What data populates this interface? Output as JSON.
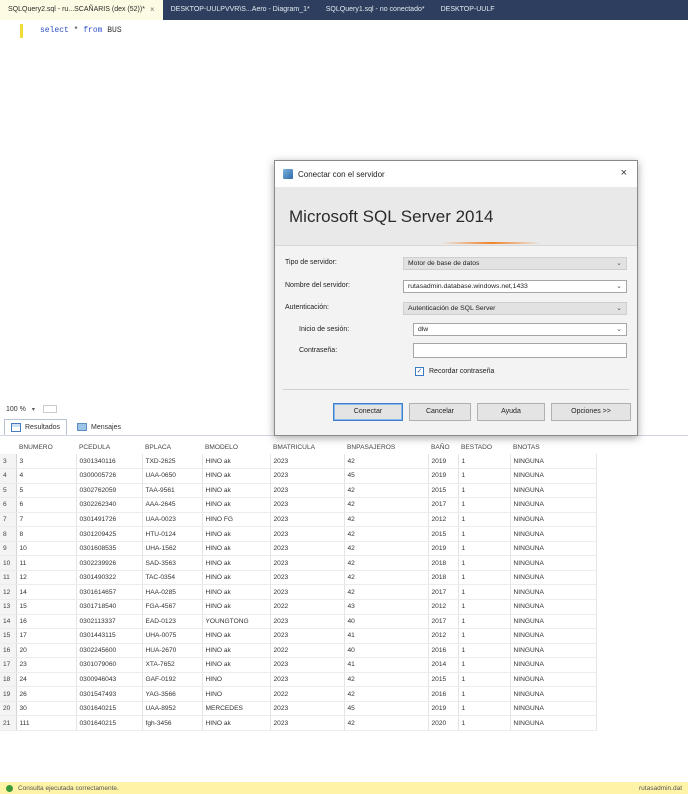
{
  "tabs": [
    {
      "label": "SQLQuery2.sql - ru...SCAÑARIS (dex (52))*",
      "active": true,
      "close": "×"
    },
    {
      "label": "DESKTOP-UULPVVR\\S...Aero - Diagram_1*",
      "active": false
    },
    {
      "label": "SQLQuery1.sql - no conectado*",
      "active": false
    },
    {
      "label": "DESKTOP-UULF",
      "active": false
    }
  ],
  "editor": {
    "keyword_select": "select",
    "keyword_from": "from",
    "code_rest": " * ",
    "table_name": " BUS"
  },
  "zoom": {
    "value": "100 %",
    "arrow": "▾"
  },
  "results_tabs": {
    "results": "Resultados",
    "messages": "Mensajes"
  },
  "grid": {
    "columns": [
      "BNUMERO",
      "PCEDULA",
      "BPLACA",
      "BMODELO",
      "BMATRICULA",
      "BNPASAJEROS",
      "BAÑO",
      "BESTADO",
      "BNOTAS"
    ],
    "rows": [
      [
        "3",
        "3",
        "0301340116",
        "TXD-2625",
        "HINO ak",
        "2023",
        "42",
        "2019",
        "1",
        "NINGUNA"
      ],
      [
        "4",
        "4",
        "0300005726",
        "UAA-0650",
        "HINO ak",
        "2023",
        "45",
        "2019",
        "1",
        "NINGUNA"
      ],
      [
        "5",
        "5",
        "0302762059",
        "TAA-9561",
        "HINO ak",
        "2023",
        "42",
        "2015",
        "1",
        "NINGUNA"
      ],
      [
        "6",
        "6",
        "0302262340",
        "AAA-2645",
        "HINO ak",
        "2023",
        "42",
        "2017",
        "1",
        "NINGUNA"
      ],
      [
        "7",
        "7",
        "0301491726",
        "UAA-0023",
        "HINO FG",
        "2023",
        "42",
        "2012",
        "1",
        "NINGUNA"
      ],
      [
        "8",
        "8",
        "0301209425",
        "HTU-0124",
        "HINO ak",
        "2023",
        "42",
        "2015",
        "1",
        "NINGUNA"
      ],
      [
        "9",
        "10",
        "0301608535",
        "UHA-1562",
        "HINO ak",
        "2023",
        "42",
        "2019",
        "1",
        "NINGUNA"
      ],
      [
        "10",
        "11",
        "0302239926",
        "SAD-3563",
        "HINO ak",
        "2023",
        "42",
        "2018",
        "1",
        "NINGUNA"
      ],
      [
        "11",
        "12",
        "0301490322",
        "TAC-0354",
        "HINO ak",
        "2023",
        "42",
        "2018",
        "1",
        "NINGUNA"
      ],
      [
        "12",
        "14",
        "0301614657",
        "HAA-0285",
        "HINO ak",
        "2023",
        "42",
        "2017",
        "1",
        "NINGUNA"
      ],
      [
        "13",
        "15",
        "0301718540",
        "FGA-4567",
        "HINO ak",
        "2022",
        "43",
        "2012",
        "1",
        "NINGUNA"
      ],
      [
        "14",
        "16",
        "0302113337",
        "EAD-0123",
        "YOUNGTONG",
        "2023",
        "40",
        "2017",
        "1",
        "NINGUNA"
      ],
      [
        "15",
        "17",
        "0301443115",
        "UHA-0075",
        "HINO ak",
        "2023",
        "41",
        "2012",
        "1",
        "NINGUNA"
      ],
      [
        "16",
        "20",
        "0302245600",
        "HUA-2670",
        "HINO ak",
        "2022",
        "40",
        "2016",
        "1",
        "NINGUNA"
      ],
      [
        "17",
        "23",
        "0301079060",
        "XTA-7652",
        "HINO ak",
        "2023",
        "41",
        "2014",
        "1",
        "NINGUNA"
      ],
      [
        "18",
        "24",
        "0300946043",
        "GAF-0192",
        "HINO",
        "2023",
        "42",
        "2015",
        "1",
        "NINGUNA"
      ],
      [
        "19",
        "26",
        "0301547493",
        "YAG-3566",
        "HINO",
        "2022",
        "42",
        "2016",
        "1",
        "NINGUNA"
      ],
      [
        "20",
        "30",
        "0301640215",
        "UAA-8952",
        "MERCEDES",
        "2023",
        "45",
        "2019",
        "1",
        "NINGUNA"
      ],
      [
        "21",
        "111",
        "0301640215",
        "fgh-3456",
        "HINO ak",
        "2023",
        "42",
        "2020",
        "1",
        "NINGUNA"
      ]
    ]
  },
  "dialog": {
    "title": "Conectar con el servidor",
    "close": "×",
    "product": "Microsoft SQL Server 2014",
    "server_type_label": "Tipo de servidor:",
    "server_type_value": "Motor de base de datos",
    "server_name_label": "Nombre del servidor:",
    "server_name_value": "rutasadmin.database.windows.net,1433",
    "auth_label": "Autenticación:",
    "auth_value": "Autenticación de SQL Server",
    "login_label": "Inicio de sesión:",
    "login_value": "dlw",
    "password_label": "Contraseña:",
    "remember_label": "Recordar contraseña",
    "remember_checked": true,
    "checkmark": "✓",
    "dropdown_arrow": "⌄",
    "buttons": {
      "connect": "Conectar",
      "cancel": "Cancelar",
      "help": "Ayuda",
      "options": "Opciones >>"
    }
  },
  "status": {
    "message": "Consulta ejecutada correctamente.",
    "right": "rutasadmin.dat"
  }
}
